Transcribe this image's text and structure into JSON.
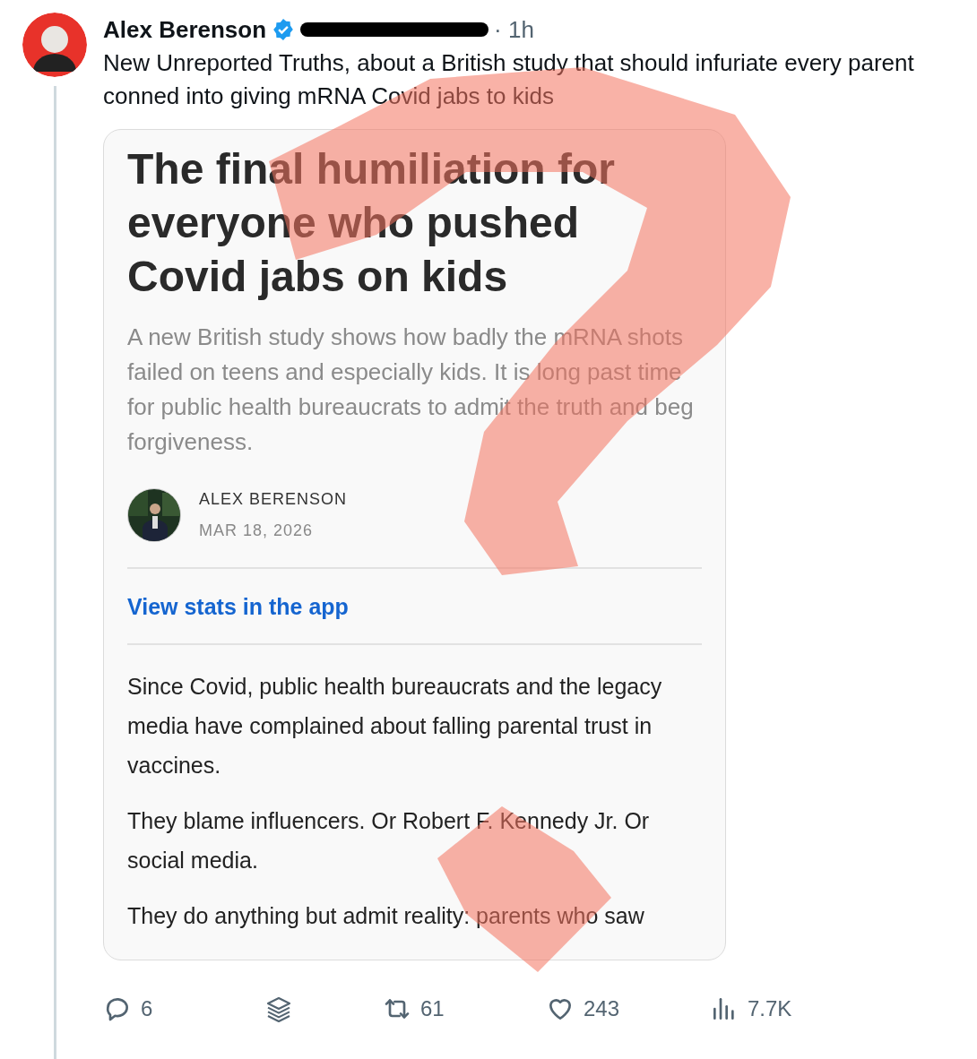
{
  "author": {
    "name": "Alex Berenson",
    "verified": true,
    "time": "· 1h"
  },
  "text": "New Unreported Truths, about a British study that should infuriate every parent conned into giving mRNA Covid jabs to kids",
  "card": {
    "headline": "The final humiliation for everyone who pushed Covid jabs on kids",
    "subtitle": "A new British study shows how badly the mRNA shots failed on teens and especially kids. It is long past time for public health bureaucrats to admit the truth and beg forgiveness.",
    "byline": {
      "name": "ALEX BERENSON",
      "date": "MAR 18, 2026"
    },
    "link": "View stats in the app",
    "paragraphs": [
      "Since Covid, public health bureaucrats and the legacy media have complained about falling parental trust in vaccines.",
      "They blame influencers. Or Robert F. Kennedy Jr. Or social media.",
      "They do anything but admit reality: parents who saw"
    ]
  },
  "actions": [
    {
      "kind": "reply",
      "count": "6"
    },
    {
      "kind": "stack"
    },
    {
      "kind": "repost",
      "count": "61"
    },
    {
      "kind": "like",
      "count": "243"
    },
    {
      "kind": "views",
      "count": "7.7K"
    }
  ]
}
